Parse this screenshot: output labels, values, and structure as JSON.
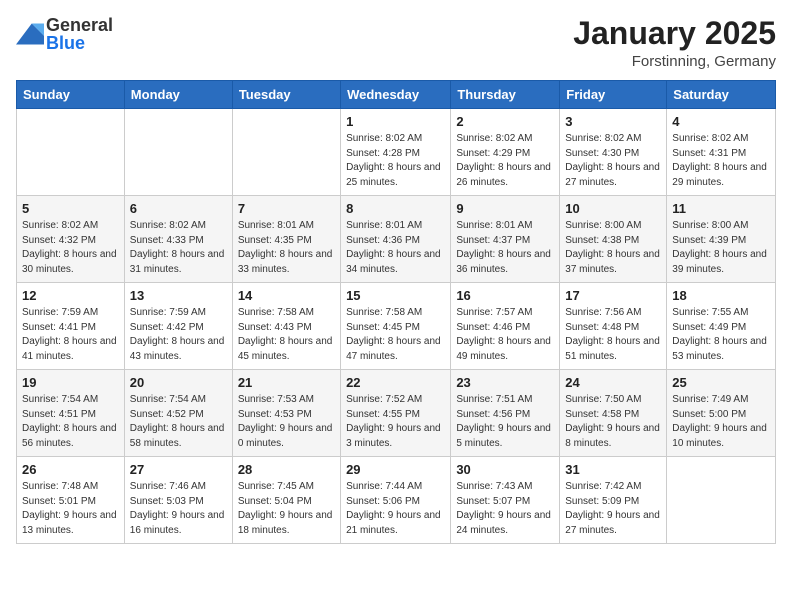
{
  "logo": {
    "general": "General",
    "blue": "Blue"
  },
  "title": "January 2025",
  "subtitle": "Forstinning, Germany",
  "days_header": [
    "Sunday",
    "Monday",
    "Tuesday",
    "Wednesday",
    "Thursday",
    "Friday",
    "Saturday"
  ],
  "weeks": [
    [
      {
        "num": "",
        "sunrise": "",
        "sunset": "",
        "daylight": ""
      },
      {
        "num": "",
        "sunrise": "",
        "sunset": "",
        "daylight": ""
      },
      {
        "num": "",
        "sunrise": "",
        "sunset": "",
        "daylight": ""
      },
      {
        "num": "1",
        "sunrise": "Sunrise: 8:02 AM",
        "sunset": "Sunset: 4:28 PM",
        "daylight": "Daylight: 8 hours and 25 minutes."
      },
      {
        "num": "2",
        "sunrise": "Sunrise: 8:02 AM",
        "sunset": "Sunset: 4:29 PM",
        "daylight": "Daylight: 8 hours and 26 minutes."
      },
      {
        "num": "3",
        "sunrise": "Sunrise: 8:02 AM",
        "sunset": "Sunset: 4:30 PM",
        "daylight": "Daylight: 8 hours and 27 minutes."
      },
      {
        "num": "4",
        "sunrise": "Sunrise: 8:02 AM",
        "sunset": "Sunset: 4:31 PM",
        "daylight": "Daylight: 8 hours and 29 minutes."
      }
    ],
    [
      {
        "num": "5",
        "sunrise": "Sunrise: 8:02 AM",
        "sunset": "Sunset: 4:32 PM",
        "daylight": "Daylight: 8 hours and 30 minutes."
      },
      {
        "num": "6",
        "sunrise": "Sunrise: 8:02 AM",
        "sunset": "Sunset: 4:33 PM",
        "daylight": "Daylight: 8 hours and 31 minutes."
      },
      {
        "num": "7",
        "sunrise": "Sunrise: 8:01 AM",
        "sunset": "Sunset: 4:35 PM",
        "daylight": "Daylight: 8 hours and 33 minutes."
      },
      {
        "num": "8",
        "sunrise": "Sunrise: 8:01 AM",
        "sunset": "Sunset: 4:36 PM",
        "daylight": "Daylight: 8 hours and 34 minutes."
      },
      {
        "num": "9",
        "sunrise": "Sunrise: 8:01 AM",
        "sunset": "Sunset: 4:37 PM",
        "daylight": "Daylight: 8 hours and 36 minutes."
      },
      {
        "num": "10",
        "sunrise": "Sunrise: 8:00 AM",
        "sunset": "Sunset: 4:38 PM",
        "daylight": "Daylight: 8 hours and 37 minutes."
      },
      {
        "num": "11",
        "sunrise": "Sunrise: 8:00 AM",
        "sunset": "Sunset: 4:39 PM",
        "daylight": "Daylight: 8 hours and 39 minutes."
      }
    ],
    [
      {
        "num": "12",
        "sunrise": "Sunrise: 7:59 AM",
        "sunset": "Sunset: 4:41 PM",
        "daylight": "Daylight: 8 hours and 41 minutes."
      },
      {
        "num": "13",
        "sunrise": "Sunrise: 7:59 AM",
        "sunset": "Sunset: 4:42 PM",
        "daylight": "Daylight: 8 hours and 43 minutes."
      },
      {
        "num": "14",
        "sunrise": "Sunrise: 7:58 AM",
        "sunset": "Sunset: 4:43 PM",
        "daylight": "Daylight: 8 hours and 45 minutes."
      },
      {
        "num": "15",
        "sunrise": "Sunrise: 7:58 AM",
        "sunset": "Sunset: 4:45 PM",
        "daylight": "Daylight: 8 hours and 47 minutes."
      },
      {
        "num": "16",
        "sunrise": "Sunrise: 7:57 AM",
        "sunset": "Sunset: 4:46 PM",
        "daylight": "Daylight: 8 hours and 49 minutes."
      },
      {
        "num": "17",
        "sunrise": "Sunrise: 7:56 AM",
        "sunset": "Sunset: 4:48 PM",
        "daylight": "Daylight: 8 hours and 51 minutes."
      },
      {
        "num": "18",
        "sunrise": "Sunrise: 7:55 AM",
        "sunset": "Sunset: 4:49 PM",
        "daylight": "Daylight: 8 hours and 53 minutes."
      }
    ],
    [
      {
        "num": "19",
        "sunrise": "Sunrise: 7:54 AM",
        "sunset": "Sunset: 4:51 PM",
        "daylight": "Daylight: 8 hours and 56 minutes."
      },
      {
        "num": "20",
        "sunrise": "Sunrise: 7:54 AM",
        "sunset": "Sunset: 4:52 PM",
        "daylight": "Daylight: 8 hours and 58 minutes."
      },
      {
        "num": "21",
        "sunrise": "Sunrise: 7:53 AM",
        "sunset": "Sunset: 4:53 PM",
        "daylight": "Daylight: 9 hours and 0 minutes."
      },
      {
        "num": "22",
        "sunrise": "Sunrise: 7:52 AM",
        "sunset": "Sunset: 4:55 PM",
        "daylight": "Daylight: 9 hours and 3 minutes."
      },
      {
        "num": "23",
        "sunrise": "Sunrise: 7:51 AM",
        "sunset": "Sunset: 4:56 PM",
        "daylight": "Daylight: 9 hours and 5 minutes."
      },
      {
        "num": "24",
        "sunrise": "Sunrise: 7:50 AM",
        "sunset": "Sunset: 4:58 PM",
        "daylight": "Daylight: 9 hours and 8 minutes."
      },
      {
        "num": "25",
        "sunrise": "Sunrise: 7:49 AM",
        "sunset": "Sunset: 5:00 PM",
        "daylight": "Daylight: 9 hours and 10 minutes."
      }
    ],
    [
      {
        "num": "26",
        "sunrise": "Sunrise: 7:48 AM",
        "sunset": "Sunset: 5:01 PM",
        "daylight": "Daylight: 9 hours and 13 minutes."
      },
      {
        "num": "27",
        "sunrise": "Sunrise: 7:46 AM",
        "sunset": "Sunset: 5:03 PM",
        "daylight": "Daylight: 9 hours and 16 minutes."
      },
      {
        "num": "28",
        "sunrise": "Sunrise: 7:45 AM",
        "sunset": "Sunset: 5:04 PM",
        "daylight": "Daylight: 9 hours and 18 minutes."
      },
      {
        "num": "29",
        "sunrise": "Sunrise: 7:44 AM",
        "sunset": "Sunset: 5:06 PM",
        "daylight": "Daylight: 9 hours and 21 minutes."
      },
      {
        "num": "30",
        "sunrise": "Sunrise: 7:43 AM",
        "sunset": "Sunset: 5:07 PM",
        "daylight": "Daylight: 9 hours and 24 minutes."
      },
      {
        "num": "31",
        "sunrise": "Sunrise: 7:42 AM",
        "sunset": "Sunset: 5:09 PM",
        "daylight": "Daylight: 9 hours and 27 minutes."
      },
      {
        "num": "",
        "sunrise": "",
        "sunset": "",
        "daylight": ""
      }
    ]
  ]
}
